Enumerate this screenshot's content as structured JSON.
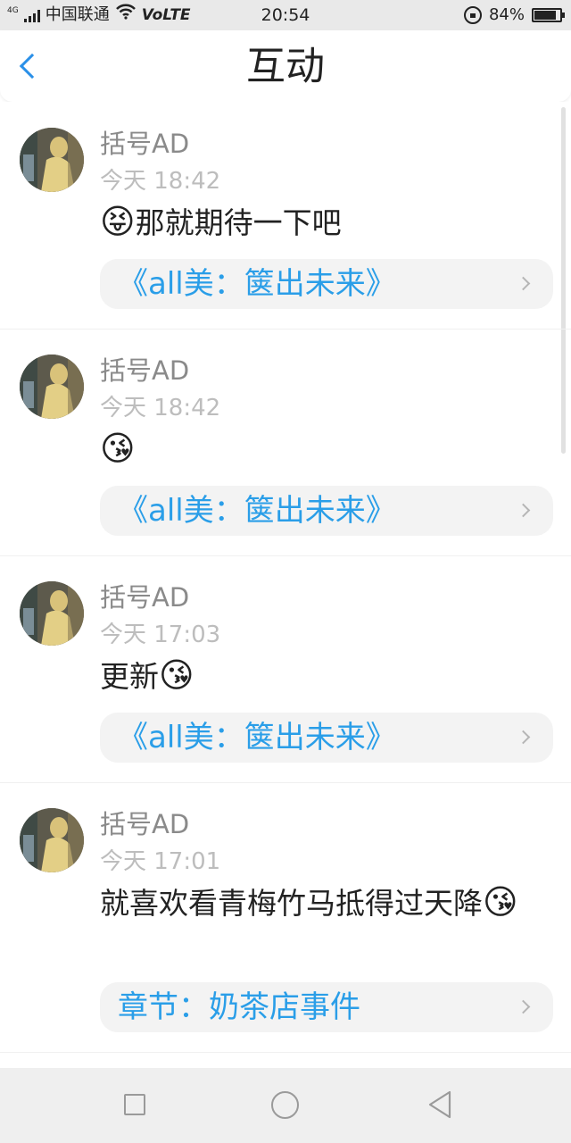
{
  "status_bar": {
    "net_tag": "4G",
    "carrier": "中国联通",
    "wifi_icon": "wifi-icon",
    "volte": "VoLTE",
    "time": "20:54",
    "battery": "84%",
    "battery_level": 0.84
  },
  "header": {
    "back_icon": "chevron-left-icon",
    "title": "互动",
    "accent_color": "#2a90e8"
  },
  "items": [
    {
      "username": "括号AD",
      "time": "今天 18:42",
      "message_text": "那就期待一下吧",
      "emoji": "😝",
      "emoji_position": "before",
      "ref_label": "《all美：箧出未来》"
    },
    {
      "username": "括号AD",
      "time": "今天 18:42",
      "message_text": "",
      "emoji": "😘",
      "emoji_position": "after",
      "ref_label": "《all美：箧出未来》"
    },
    {
      "username": "括号AD",
      "time": "今天 17:03",
      "message_text": "更新",
      "emoji": "😘",
      "emoji_position": "after",
      "ref_label": "《all美：箧出未来》"
    },
    {
      "username": "括号AD",
      "time": "今天 17:01",
      "message_text": "就喜欢看青梅竹马抵得过天降",
      "emoji": "😘",
      "emoji_position": "after",
      "ref_label": "章节：奶茶店事件"
    }
  ],
  "nav_bar": {
    "recent_icon": "square-icon",
    "home_icon": "circle-icon",
    "back_icon": "triangle-back-icon"
  },
  "colors": {
    "link": "#2a9ee8",
    "username": "#8a8a8a",
    "timestamp": "#bdbdbd"
  }
}
